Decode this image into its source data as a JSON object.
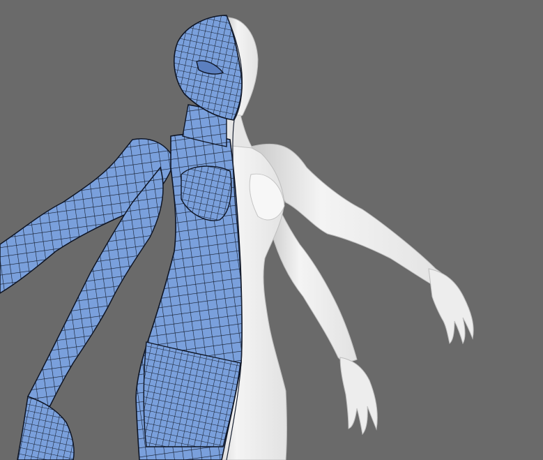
{
  "viewport": {
    "background_color": "#6a6a6a"
  },
  "model": {
    "wireframe_fill_color": "#7aa0dc",
    "wireframe_line_color": "#121a2a",
    "shaded_color": "#f2f2f2",
    "shaded_shadow_color": "#c9c9c9"
  }
}
